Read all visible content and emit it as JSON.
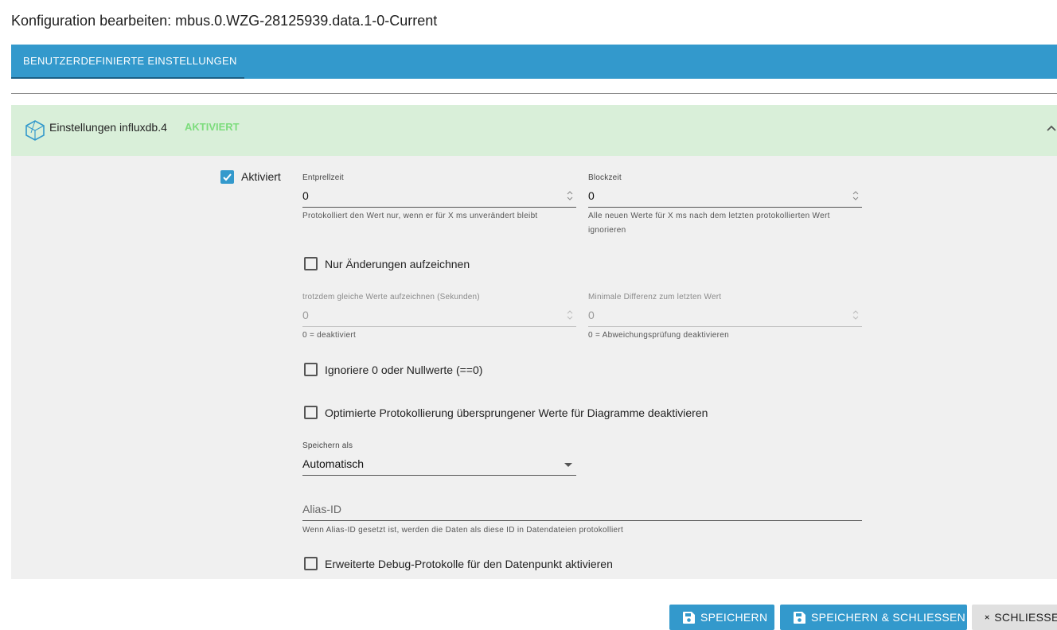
{
  "dialog": {
    "title": "Konfiguration bearbeiten: mbus.0.WZG-28125939.data.1-0-Current"
  },
  "tabs": [
    {
      "label": "BENUTZERDEFINIERTE EINSTELLUNGEN"
    }
  ],
  "panel": {
    "title": "Einstellungen influxdb.4",
    "status": "AKTIVIERT",
    "status_color": "#7ddc7d",
    "header_bg": "#d9efd9"
  },
  "settings": {
    "enabled": {
      "label": "Aktiviert",
      "checked": true
    },
    "debounce": {
      "label": "Entprellzeit",
      "value": "0",
      "helper": "Protokolliert den Wert nur, wenn er für X ms unverändert bleibt"
    },
    "blocktime": {
      "label": "Blockzeit",
      "value": "0",
      "helper1": "Alle neuen Werte für X ms nach dem letzten protokollierten Wert",
      "helper2": "ignorieren"
    },
    "changes_only": {
      "label": "Nur Änderungen aufzeichnen",
      "checked": false
    },
    "still_record": {
      "label": "trotzdem gleiche Werte aufzeichnen (Sekunden)",
      "value": "0",
      "helper": "0 = deaktiviert"
    },
    "min_diff": {
      "label": "Minimale Differenz zum letzten Wert",
      "value": "0",
      "helper": "0 = Abweichungsprüfung deaktivieren"
    },
    "ignore_zero": {
      "label": "Ignoriere 0 oder Nullwerte (==0)",
      "checked": false
    },
    "disable_skipped": {
      "label": "Optimierte Protokollierung übersprungener Werte für Diagramme deaktivieren",
      "checked": false
    },
    "store_as": {
      "label": "Speichern als",
      "value": "Automatisch"
    },
    "alias": {
      "placeholder": "Alias-ID",
      "helper": "Wenn Alias-ID gesetzt ist, werden die Daten als diese ID in Datendateien protokolliert"
    },
    "debug": {
      "label": "Erweiterte Debug-Protokolle für den Datenpunkt aktivieren",
      "checked": false
    }
  },
  "footer": {
    "save": "SPEICHERN",
    "save_close": "SPEICHERN & SCHLIESSEN",
    "close": "SCHLIESSEN"
  },
  "colors": {
    "accent": "#3399cc"
  }
}
